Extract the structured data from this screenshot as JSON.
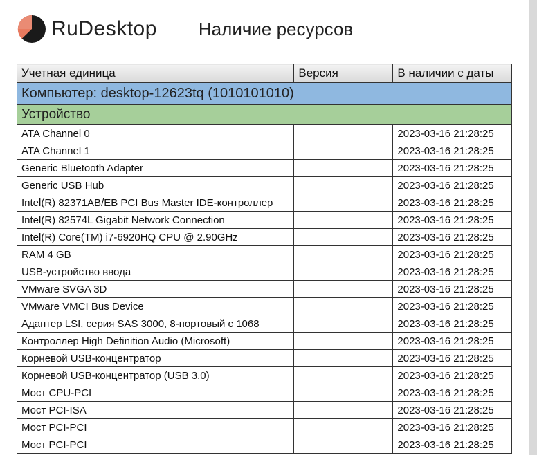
{
  "logo_text": "RuDesktop",
  "page_title": "Наличие ресурсов",
  "columns": {
    "unit": "Учетная единица",
    "version": "Версия",
    "since": "В наличии с даты"
  },
  "computer_row": "Компьютер: desktop-12623tq (1010101010)",
  "section_row": "Устройство",
  "rows": [
    {
      "name": "ATA Channel 0",
      "version": "",
      "date": "2023-03-16 21:28:25"
    },
    {
      "name": "ATA Channel 1",
      "version": "",
      "date": "2023-03-16 21:28:25"
    },
    {
      "name": "Generic Bluetooth Adapter",
      "version": "",
      "date": "2023-03-16 21:28:25"
    },
    {
      "name": "Generic USB Hub",
      "version": "",
      "date": "2023-03-16 21:28:25"
    },
    {
      "name": "Intel(R) 82371AB/EB PCI Bus Master IDE-контроллер",
      "version": "",
      "date": "2023-03-16 21:28:25"
    },
    {
      "name": "Intel(R) 82574L Gigabit Network Connection",
      "version": "",
      "date": "2023-03-16 21:28:25"
    },
    {
      "name": "Intel(R) Core(TM) i7-6920HQ CPU @ 2.90GHz",
      "version": "",
      "date": "2023-03-16 21:28:25"
    },
    {
      "name": "RAM 4 GB",
      "version": "",
      "date": "2023-03-16 21:28:25"
    },
    {
      "name": "USB-устройство ввода",
      "version": "",
      "date": "2023-03-16 21:28:25"
    },
    {
      "name": "VMware SVGA 3D",
      "version": "",
      "date": "2023-03-16 21:28:25"
    },
    {
      "name": "VMware VMCI Bus Device",
      "version": "",
      "date": "2023-03-16 21:28:25"
    },
    {
      "name": "Адаптер LSI, серия SAS 3000, 8-портовый с 1068",
      "version": "",
      "date": "2023-03-16 21:28:25"
    },
    {
      "name": "Контроллер High Definition Audio (Microsoft)",
      "version": "",
      "date": "2023-03-16 21:28:25"
    },
    {
      "name": "Корневой USB-концентратор",
      "version": "",
      "date": "2023-03-16 21:28:25"
    },
    {
      "name": "Корневой USB-концентратор (USB 3.0)",
      "version": "",
      "date": "2023-03-16 21:28:25"
    },
    {
      "name": "Мост CPU-PCI",
      "version": "",
      "date": "2023-03-16 21:28:25"
    },
    {
      "name": "Мост PCI-ISA",
      "version": "",
      "date": "2023-03-16 21:28:25"
    },
    {
      "name": "Мост PCI-PCI",
      "version": "",
      "date": "2023-03-16 21:28:25"
    },
    {
      "name": "Мост PCI-PCI",
      "version": "",
      "date": "2023-03-16 21:28:25"
    }
  ]
}
